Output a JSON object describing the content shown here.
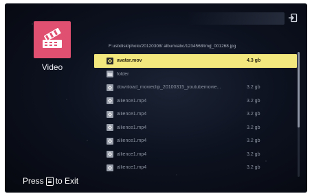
{
  "category": {
    "label": "Video",
    "icon": "film-reel-icon",
    "color": "#e05070"
  },
  "path": "F:usbdisk/photo/20120308/ album/abc/1234568/img_001268.jpg",
  "files": [
    {
      "name": "avatar.mov",
      "size": "4.3 gb",
      "type": "video",
      "selected": true
    },
    {
      "name": "folder",
      "size": "",
      "type": "folder",
      "selected": false
    },
    {
      "name": "download_movieclip_20100315_youtubemovie...",
      "size": "3.2 gb",
      "type": "video",
      "selected": false
    },
    {
      "name": "allience1.mp4",
      "size": "3.2 gb",
      "type": "video",
      "selected": false
    },
    {
      "name": "allience1.mp4",
      "size": "3.2 gb",
      "type": "video",
      "selected": false
    },
    {
      "name": "allience1.mp4",
      "size": "3.2 gb",
      "type": "video",
      "selected": false
    },
    {
      "name": "allience1.mp4",
      "size": "3.2 gb",
      "type": "video",
      "selected": false
    },
    {
      "name": "allience1.mp4",
      "size": "3.2 gb",
      "type": "video",
      "selected": false
    },
    {
      "name": "allience1.mp4",
      "size": "3.2 gb",
      "type": "video",
      "selected": false
    }
  ],
  "hint": {
    "press": "Press",
    "to_exit": "to Exit"
  },
  "colors": {
    "selection": "#f2e87e",
    "background": "#0d1220"
  }
}
